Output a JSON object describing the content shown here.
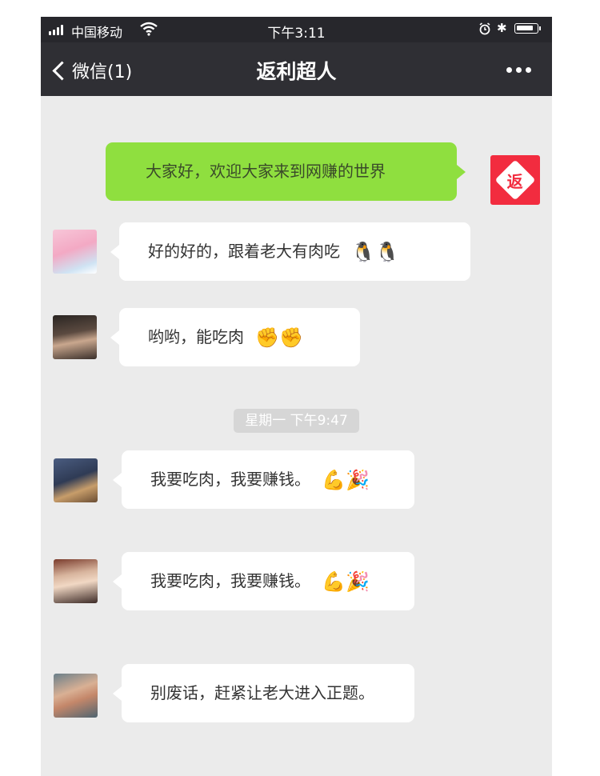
{
  "status_bar": {
    "carrier": "中国移动",
    "time": "下午3:11"
  },
  "nav": {
    "back_label": "微信(1)",
    "title": "返利超人"
  },
  "brand": {
    "avatar_char": "返",
    "color": "#f22c3f"
  },
  "messages": [
    {
      "side": "right",
      "text": "大家好，欢迎大家来到网赚的世界",
      "emojis": ""
    },
    {
      "side": "left",
      "text": "好的好的，跟着老大有肉吃",
      "emojis": "🐧🐧"
    },
    {
      "side": "left",
      "text": "哟哟，能吃肉",
      "emojis": "✊✊"
    },
    {
      "side": "left",
      "text": "我要吃肉，我要赚钱。",
      "emojis": "💪🎉"
    },
    {
      "side": "left",
      "text": "我要吃肉，我要赚钱。",
      "emojis": "💪🎉"
    },
    {
      "side": "left",
      "text": "别废话，赶紧让老大进入正题。",
      "emojis": ""
    }
  ],
  "timestamp": "星期一 下午9:47",
  "colors": {
    "status_bar": "#27272c",
    "nav_bar": "#2f2f34",
    "chat_bg": "#ebebeb",
    "outgoing_bubble": "#8fdf3f",
    "incoming_bubble": "#ffffff"
  }
}
